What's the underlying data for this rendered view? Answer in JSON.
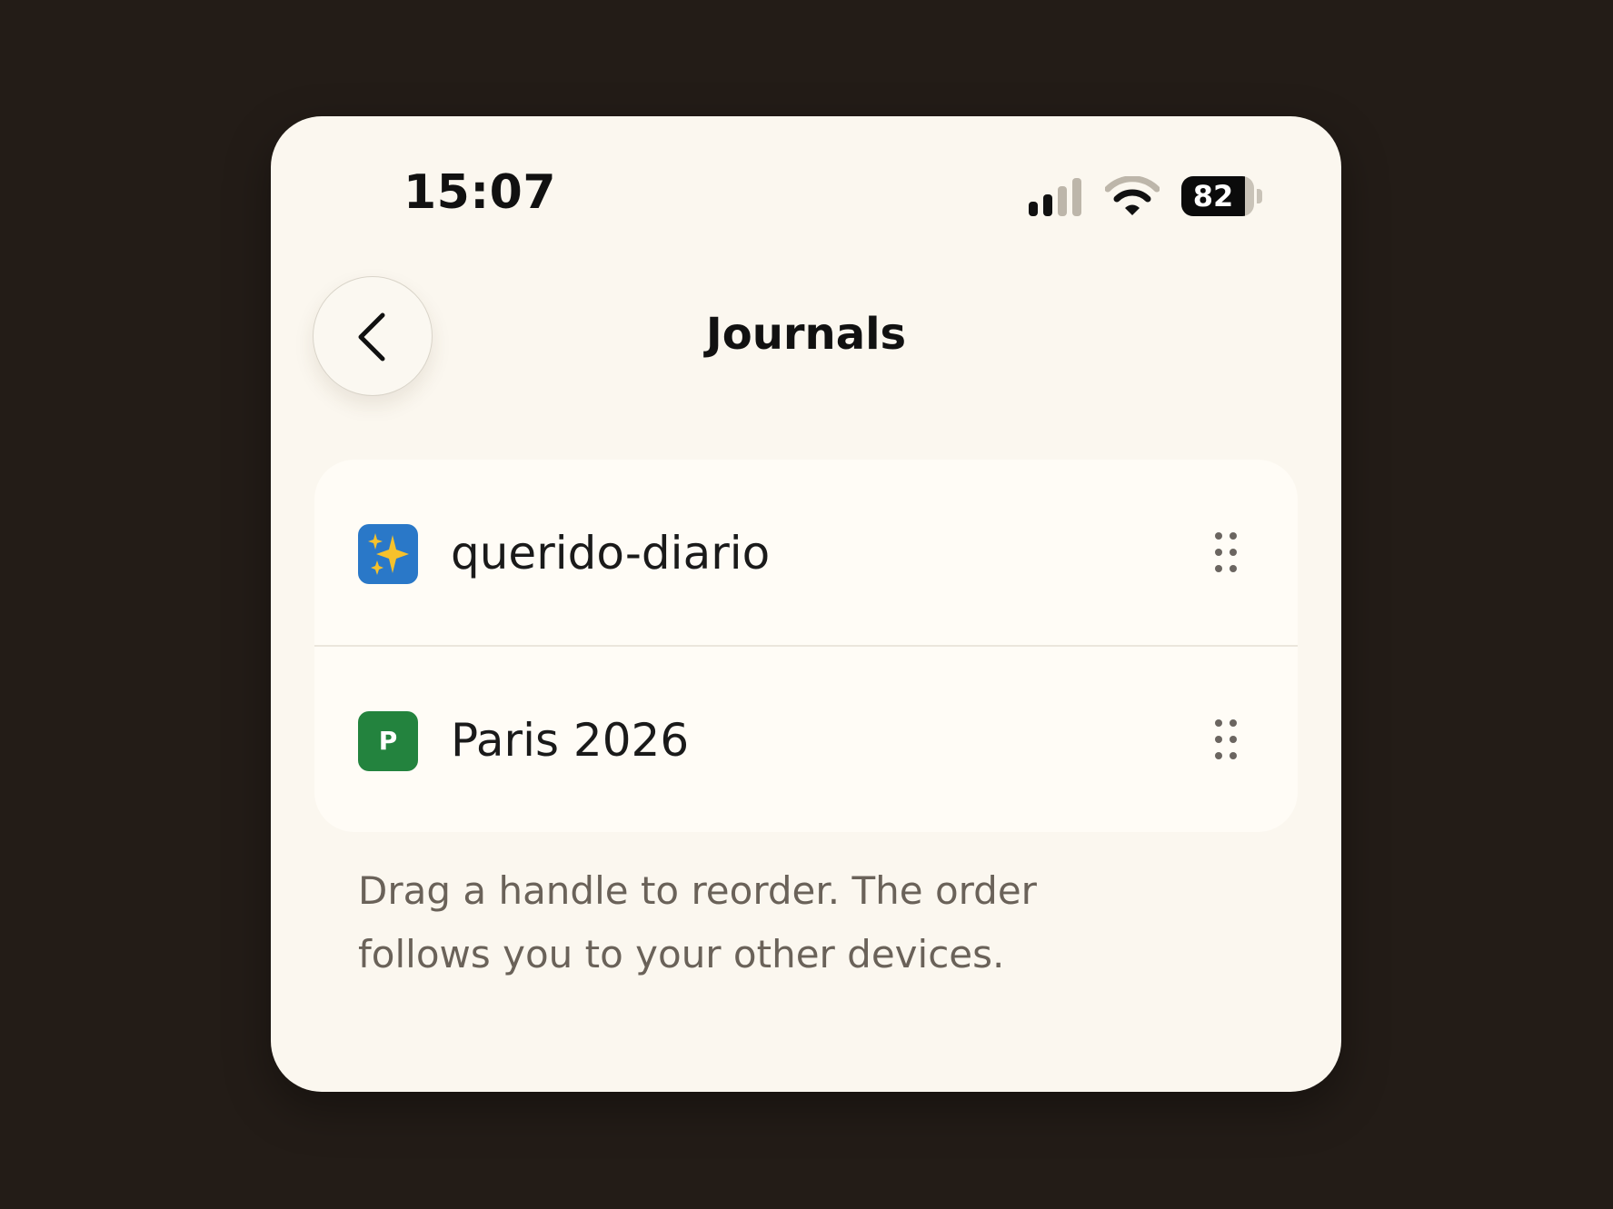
{
  "status_bar": {
    "time": "15:07",
    "battery_level": "82",
    "battery_fraction": 0.82,
    "signal_icon": "cellular-signal-icon",
    "wifi_icon": "wifi-icon"
  },
  "nav": {
    "back_icon": "chevron-left-icon",
    "title": "Journals"
  },
  "journals": [
    {
      "name": "querido-diario",
      "icon": "sparkles-icon",
      "icon_color": "#2a78c8",
      "icon_letter": ""
    },
    {
      "name": "Paris 2026",
      "icon": "letter-p-icon",
      "icon_color": "#23833e",
      "icon_letter": "P"
    }
  ],
  "drag_handle_icon": "drag-handle-icon",
  "footer": {
    "line1": "Drag a handle to reorder. The order",
    "line2": "follows you to your other devices."
  },
  "colors": {
    "backdrop": "#231c17",
    "screen": "#fbf7ef",
    "card": "#fffcf6",
    "text_primary": "#1a1a1a",
    "text_secondary": "#6a6259"
  }
}
